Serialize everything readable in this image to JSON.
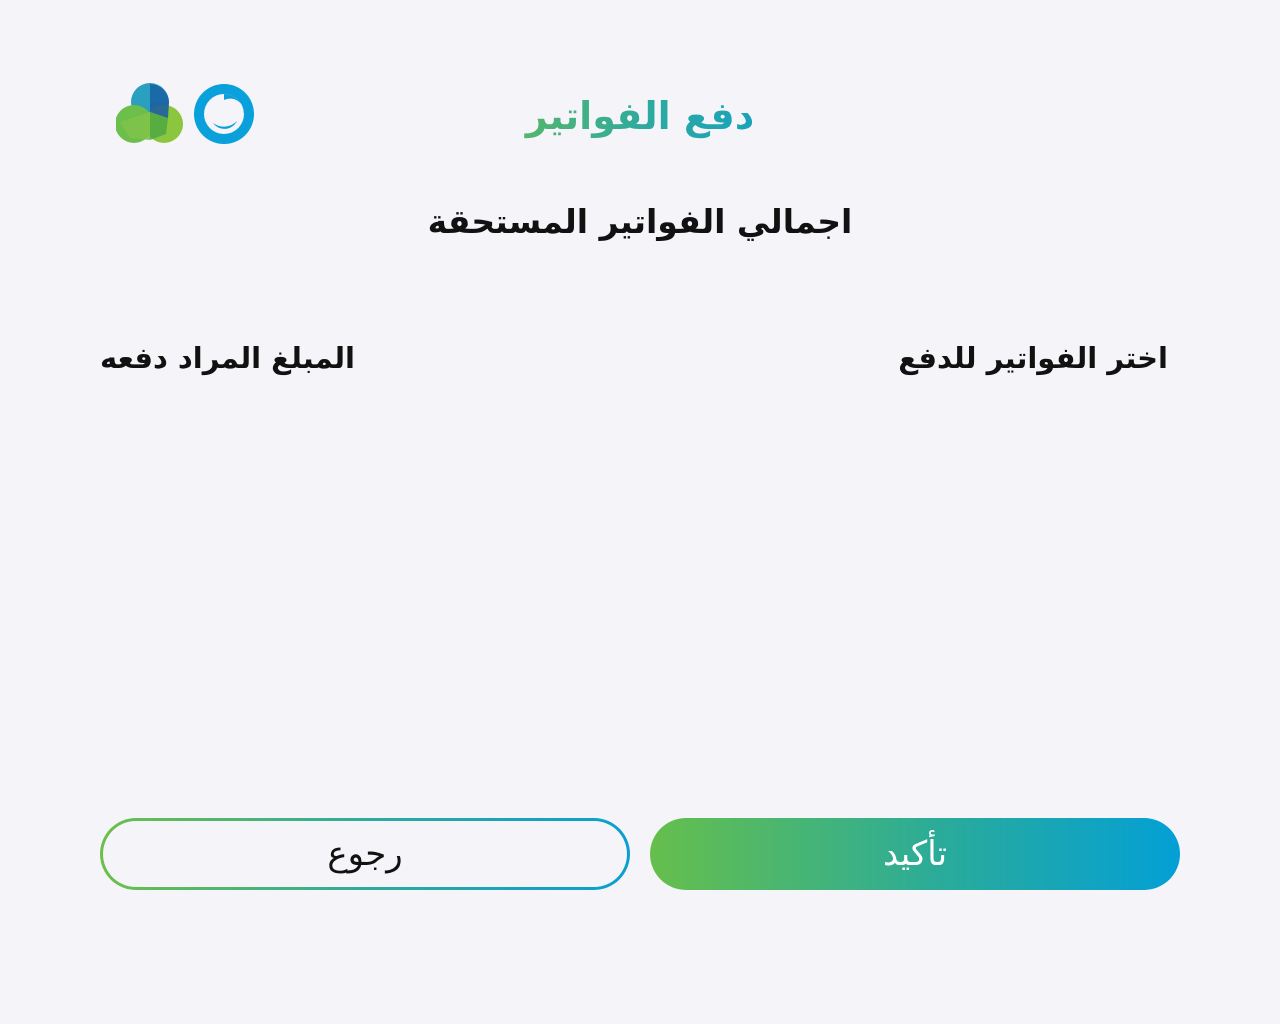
{
  "header": {
    "title": "دفع الفواتير",
    "logos": {
      "left_logo_icon": "green-blue-cluster-logo",
      "right_logo_icon": "blue-ring-logo"
    }
  },
  "main": {
    "subtitle": "اجمالي الفواتير المستحقة",
    "columns": {
      "select_invoices_label": "اختر الفواتير للدفع",
      "amount_to_pay_label": "المبلغ المراد دفعه"
    }
  },
  "actions": {
    "confirm_label": "تأكيد",
    "back_label": "رجوع"
  },
  "colors": {
    "background": "#f5f5f9",
    "gradient_start": "#66bf4c",
    "gradient_mid": "#2aab9a",
    "gradient_end": "#03a0d6",
    "text": "#111111"
  }
}
